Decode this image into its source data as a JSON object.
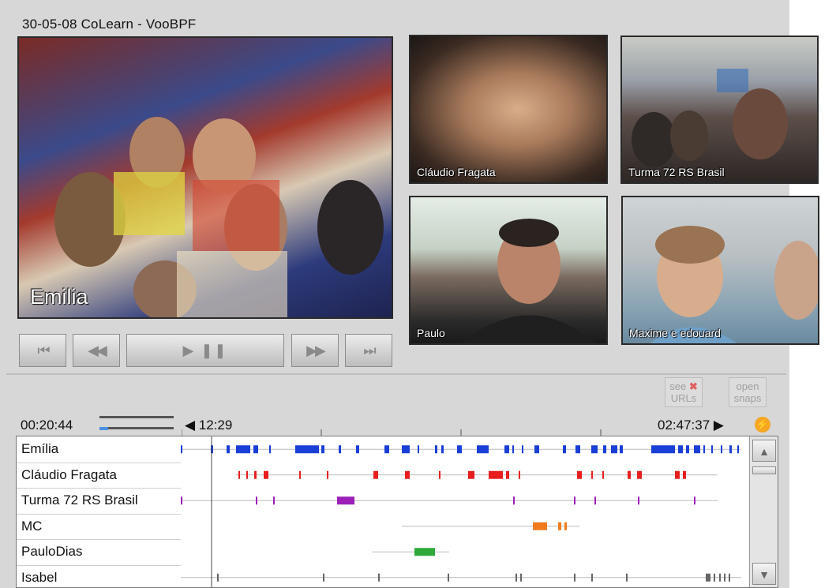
{
  "session_title": "30-05-08  CoLearn - VooBPF",
  "videos": {
    "main": {
      "label": "Emilia"
    },
    "claudio": {
      "label": "Cláudio Fragata"
    },
    "turma": {
      "label": "Turma 72 RS Brasil"
    },
    "paulo": {
      "label": "Paulo"
    },
    "maxime": {
      "label": "Maxime e edouard"
    }
  },
  "controls": {
    "first": "⏮",
    "rewind": "◀◀",
    "play_pause": "▶ ❚❚",
    "forward": "▶▶",
    "last": "⏭"
  },
  "toolbar": {
    "see_urls": {
      "line1": "see",
      "line2": "URLs",
      "icon": "✖"
    },
    "open_snaps": {
      "line1": "open",
      "line2": "snaps"
    }
  },
  "timeline": {
    "current_time": "00:20:44",
    "start_marker": "◀ 12:29",
    "end_marker": "02:47:37 ▶",
    "lightning_icon": "⚡",
    "playback_progress": 0.12,
    "participants": [
      {
        "name": "Emília",
        "color": "#1a3fd6"
      },
      {
        "name": "Cláudio Fragata",
        "color": "#e81e1e"
      },
      {
        "name": "Turma 72 RS Brasil",
        "color": "#9b1fb8"
      },
      {
        "name": "MC",
        "color": "#f07a1e"
      },
      {
        "name": "PauloDias",
        "color": "#2ea83a"
      },
      {
        "name": "Isabel",
        "color": "#666666"
      }
    ]
  },
  "scroll": {
    "up": "▲",
    "down": "▼"
  }
}
